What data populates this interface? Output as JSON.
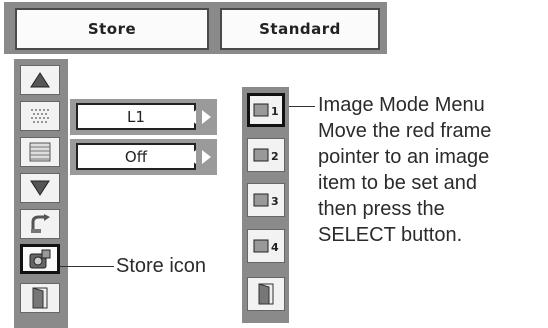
{
  "top": {
    "store_label": "Store",
    "mode_label": "Standard"
  },
  "fields": [
    {
      "value": "L1"
    },
    {
      "value": "Off"
    }
  ],
  "left_icons": [
    "up-triangle-icon",
    "dither-pattern-icon",
    "grid-icon",
    "down-triangle-icon",
    "reset-arrow-icon",
    "store-icon",
    "exit-door-icon"
  ],
  "right_icons": [
    "image-1-icon",
    "image-2-icon",
    "image-3-icon",
    "image-4-icon",
    "exit-door-icon"
  ],
  "right_icon_numbers": [
    "1",
    "2",
    "3",
    "4"
  ],
  "annotations": {
    "menu_callout": [
      "Image Mode Menu",
      "Move the red frame",
      "pointer to an image",
      "item to be set and",
      "then press the",
      "SELECT button."
    ],
    "store_callout": "Store icon"
  }
}
